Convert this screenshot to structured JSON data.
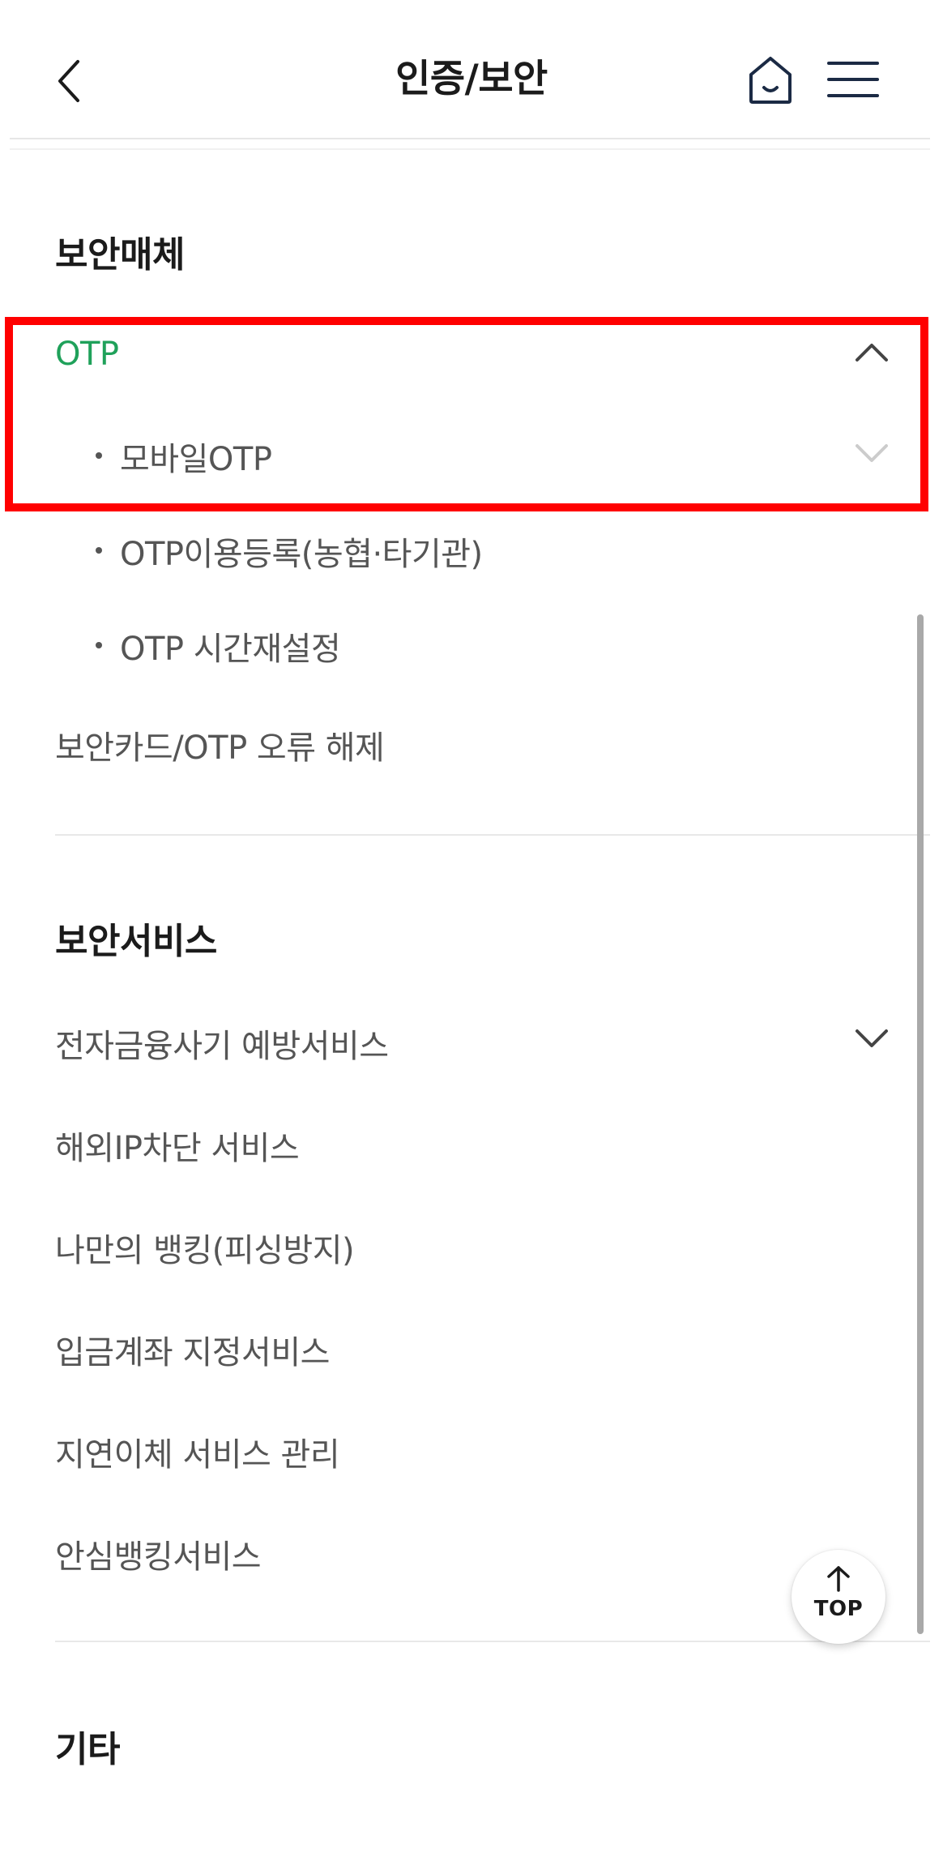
{
  "header": {
    "title": "인증/보안",
    "back_icon": "chevron-left-icon",
    "home_icon": "home-icon",
    "menu_icon": "hamburger-menu-icon"
  },
  "sections": {
    "security_media": {
      "title": "보안매체",
      "otp": {
        "label": "OTP",
        "expanded": true,
        "children": [
          {
            "label": "모바일OTP",
            "has_submenu": true
          },
          {
            "label": "OTP이용등록(농협·타기관)"
          },
          {
            "label": "OTP 시간재설정"
          }
        ]
      },
      "unlock_label": "보안카드/OTP 오류 해제"
    },
    "security_services": {
      "title": "보안서비스",
      "items": [
        {
          "label": "전자금융사기 예방서비스",
          "has_submenu": true
        },
        {
          "label": "해외IP차단 서비스"
        },
        {
          "label": "나만의 뱅킹(피싱방지)"
        },
        {
          "label": "입금계좌 지정서비스"
        },
        {
          "label": "지연이체 서비스 관리"
        },
        {
          "label": "안심뱅킹서비스"
        }
      ]
    },
    "etc": {
      "title": "기타"
    }
  },
  "top_button": {
    "label": "TOP",
    "icon": "arrow-up-icon"
  },
  "colors": {
    "active": "#1fa15a",
    "highlight": "#ff0000",
    "text": "#555555",
    "heading": "#1b1b1b"
  }
}
